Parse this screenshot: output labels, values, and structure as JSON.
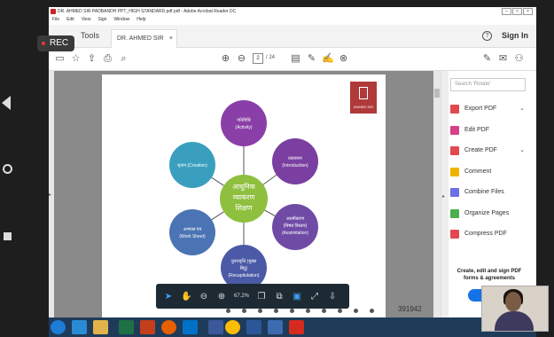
{
  "window": {
    "title": "DR. AHMED SIR PADBANDH PPT_HIGH STANDARD.pdf.pdf - Adobe Acrobat Reader DC",
    "controls": [
      "–",
      "□",
      "×"
    ]
  },
  "menu": [
    "File",
    "Edit",
    "View",
    "Sign",
    "Window",
    "Help"
  ],
  "tabs": {
    "tools": "Tools",
    "document": "DR. AHMED SIR PA...",
    "close": "×"
  },
  "header": {
    "help": "?",
    "signin": "Sign In"
  },
  "toolbar": {
    "page_current": "2",
    "page_total": "/ 24"
  },
  "slide": {
    "logo_text": "AHMED SIR",
    "page_number": "391942",
    "center": {
      "line1": "आधुनिक",
      "line2": "व्याकरण",
      "line3": "शिक्षण"
    },
    "nodes": [
      {
        "line1": "गतिविधि",
        "line2": "(Activity)",
        "color": "#8a3fa8"
      },
      {
        "line1": "प्रस्तावना",
        "line2": "(Introduction)",
        "color": "#7a3fa0"
      },
      {
        "line1": "आत्मीकरण",
        "line2": "(विषय विस्तार)",
        "line3": "(Assimilation)",
        "color": "#6f4ba6"
      },
      {
        "line1": "पुनरावृत्ति (मुख्य",
        "line2": "बिंदु)",
        "line3": "(Recapitulation)",
        "color": "#4b5aa6"
      },
      {
        "line1": "अभ्यास पत्र",
        "line2": "(Work Sheet)",
        "color": "#4a74b3"
      },
      {
        "line1": "सृजन (Creation)",
        "color": "#3a9fbf"
      }
    ]
  },
  "float_toolbar": {
    "zoom": "67.2%"
  },
  "right_panel": {
    "search_placeholder": "Search 'Rotate'",
    "tools": [
      {
        "label": "Export PDF",
        "color": "#e34850",
        "chevron": true
      },
      {
        "label": "Edit PDF",
        "color": "#d83f87",
        "chevron": false
      },
      {
        "label": "Create PDF",
        "color": "#e34850",
        "chevron": true
      },
      {
        "label": "Comment",
        "color": "#f0b400",
        "chevron": false
      },
      {
        "label": "Combine Files",
        "color": "#6e6ee6",
        "chevron": false
      },
      {
        "label": "Organize Pages",
        "color": "#4caf50",
        "chevron": false
      },
      {
        "label": "Compress PDF",
        "color": "#e34850",
        "chevron": false
      }
    ],
    "promo": "Create, edit and sign PDF forms & agreements"
  },
  "overlay": {
    "rec": "REC"
  }
}
